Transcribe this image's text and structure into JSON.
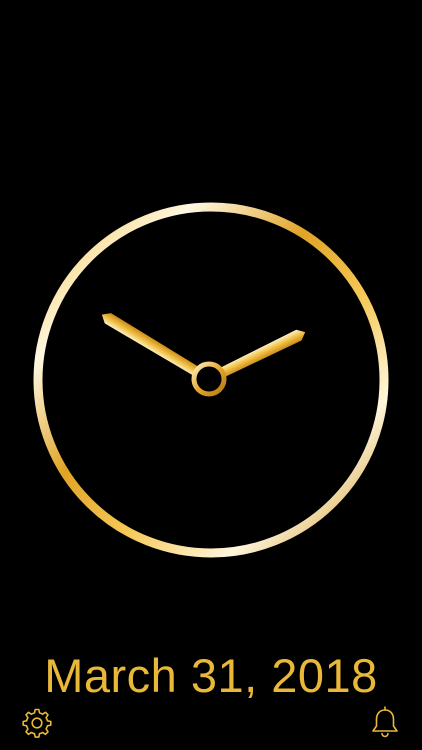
{
  "clock": {
    "hour": 10,
    "minute": 10,
    "accent_color": "#e9b838",
    "highlight_color": "#fff6dc",
    "shadow_color": "#b37a12"
  },
  "date": {
    "text": "March 31, 2018"
  },
  "toolbar": {
    "settings_icon": "gear-icon",
    "alarm_icon": "bell-icon"
  }
}
